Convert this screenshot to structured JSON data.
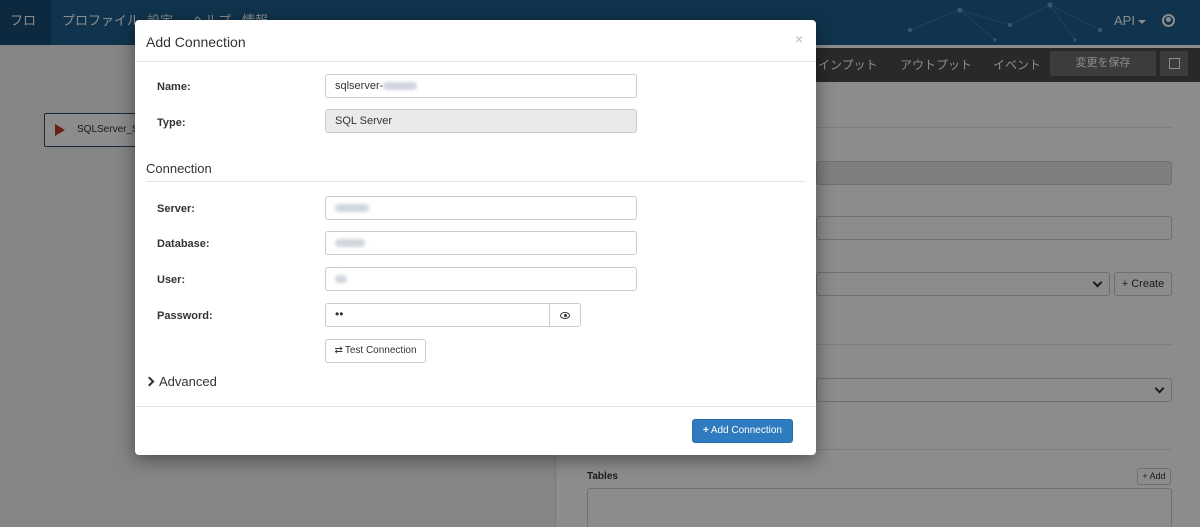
{
  "navbar": {
    "items": [
      "フロー",
      "プロファイル",
      "設定",
      "ヘルプ",
      "情報"
    ],
    "api_label": "API"
  },
  "flow": {
    "node_label": "SQLServer_Se..."
  },
  "editor": {
    "tabs": [
      "インプット",
      "アウトプット",
      "イベント"
    ],
    "save_label": "変更を保存",
    "create_label": "Create",
    "tables_label": "Tables",
    "add_label": "+ Add"
  },
  "modal": {
    "title": "Add Connection",
    "close_glyph": "×",
    "name_label": "Name:",
    "name_value_prefix": "sqlserver-",
    "type_label": "Type:",
    "type_value": "SQL Server",
    "section_connection": "Connection",
    "server_label": "Server:",
    "database_label": "Database:",
    "user_label": "User:",
    "password_label": "Password:",
    "password_value": "••",
    "test_button": "Test Connection",
    "advanced_label": "Advanced",
    "add_button": "Add Connection"
  },
  "icons": {
    "swap": "⇄",
    "plus": "+",
    "eye": "eye-icon",
    "close": "×"
  },
  "colors": {
    "navbar": "#1e5f8e",
    "primary_button": "#2f7bbf",
    "tab_bar": "#4b4b4b"
  }
}
